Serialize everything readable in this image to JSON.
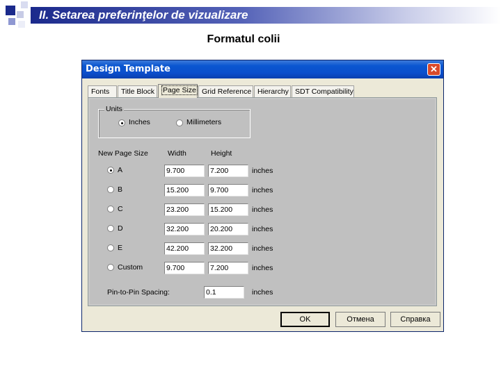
{
  "slide": {
    "title": "II. Setarea preferinţelor de vizualizare",
    "subtitle": "Formatul colii"
  },
  "dialog": {
    "title": "Design Template",
    "tabs": [
      "Fonts",
      "Title Block",
      "Page Size",
      "Grid Reference",
      "Hierarchy",
      "SDT Compatibility"
    ],
    "active_tab": "Page Size",
    "units": {
      "label": "Units",
      "options": [
        "Inches",
        "Millimeters"
      ],
      "selected": "Inches"
    },
    "columns": {
      "size": "New Page Size",
      "width": "Width",
      "height": "Height"
    },
    "page_sizes": [
      {
        "name": "A",
        "width": "9.700",
        "height": "7.200",
        "unit": "inches",
        "selected": true
      },
      {
        "name": "B",
        "width": "15.200",
        "height": "9.700",
        "unit": "inches",
        "selected": false
      },
      {
        "name": "C",
        "width": "23.200",
        "height": "15.200",
        "unit": "inches",
        "selected": false
      },
      {
        "name": "D",
        "width": "32.200",
        "height": "20.200",
        "unit": "inches",
        "selected": false
      },
      {
        "name": "E",
        "width": "42.200",
        "height": "32.200",
        "unit": "inches",
        "selected": false
      },
      {
        "name": "Custom",
        "width": "9.700",
        "height": "7.200",
        "unit": "inches",
        "selected": false
      }
    ],
    "pin_spacing": {
      "label": "Pin-to-Pin Spacing:",
      "value": "0.1",
      "unit": "inches"
    },
    "buttons": {
      "ok": "OK",
      "cancel": "Отмена",
      "help": "Справка"
    }
  }
}
